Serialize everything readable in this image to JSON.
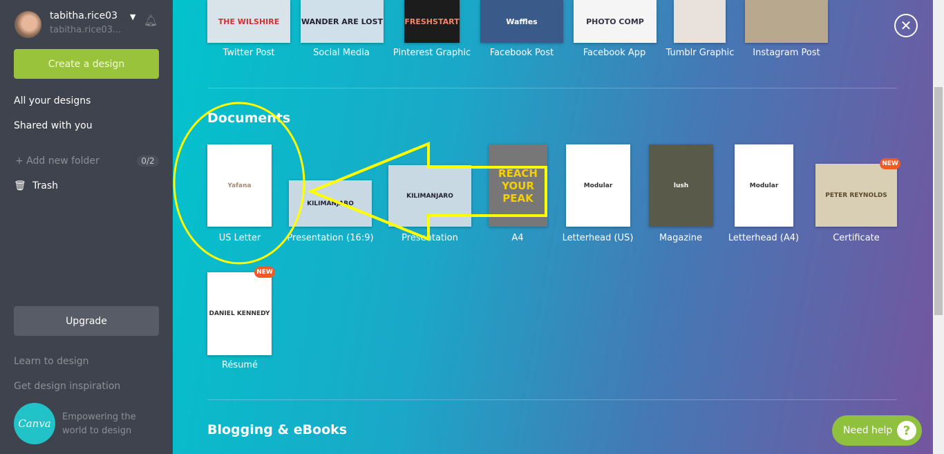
{
  "user": {
    "name": "tabitha.rice03",
    "email": "tabitha.rice03..."
  },
  "sidebar": {
    "create": "Create a design",
    "all": "All your designs",
    "shared": "Shared with you",
    "add_folder": "+ Add new folder",
    "folder_count": "0/2",
    "trash": "Trash",
    "upgrade": "Upgrade",
    "learn": "Learn to design",
    "inspire": "Get design inspiration",
    "logo": "Canva",
    "tagline": "Empowering the world to design"
  },
  "social": [
    {
      "label": "Twitter Post",
      "thumb": "THE WILSHIRE"
    },
    {
      "label": "Social Media",
      "thumb": "WANDER ARE LOST"
    },
    {
      "label": "Pinterest Graphic",
      "thumb": "FRESHSTART"
    },
    {
      "label": "Facebook Post",
      "thumb": "Waffles"
    },
    {
      "label": "Facebook App",
      "thumb": "PHOTO COMP"
    },
    {
      "label": "Tumblr Graphic",
      "thumb": ""
    },
    {
      "label": "Instagram Post",
      "thumb": ""
    }
  ],
  "documents": {
    "title": "Documents",
    "items": [
      {
        "label": "US Letter",
        "thumb": "Yafana"
      },
      {
        "label": "Presentation (16:9)",
        "thumb": "KILIMANJARO"
      },
      {
        "label": "Presentation",
        "thumb": "KILIMANJARO"
      },
      {
        "label": "A4",
        "thumb": "REACH YOUR PEAK"
      },
      {
        "label": "Letterhead (US)",
        "thumb": "Modular"
      },
      {
        "label": "Magazine",
        "thumb": "lush"
      },
      {
        "label": "Letterhead (A4)",
        "thumb": "Modular"
      },
      {
        "label": "Certificate",
        "thumb": "PETER REYNOLDS",
        "badge": "NEW"
      },
      {
        "label": "Résumé",
        "thumb": "DANIEL KENNEDY",
        "badge": "NEW"
      }
    ]
  },
  "blogging": {
    "title": "Blogging & eBooks"
  },
  "help": {
    "label": "Need help",
    "icon": "?"
  },
  "colors": {
    "accent": "#99c33b",
    "annotation": "#ffff00",
    "badge": "#f15a24"
  }
}
